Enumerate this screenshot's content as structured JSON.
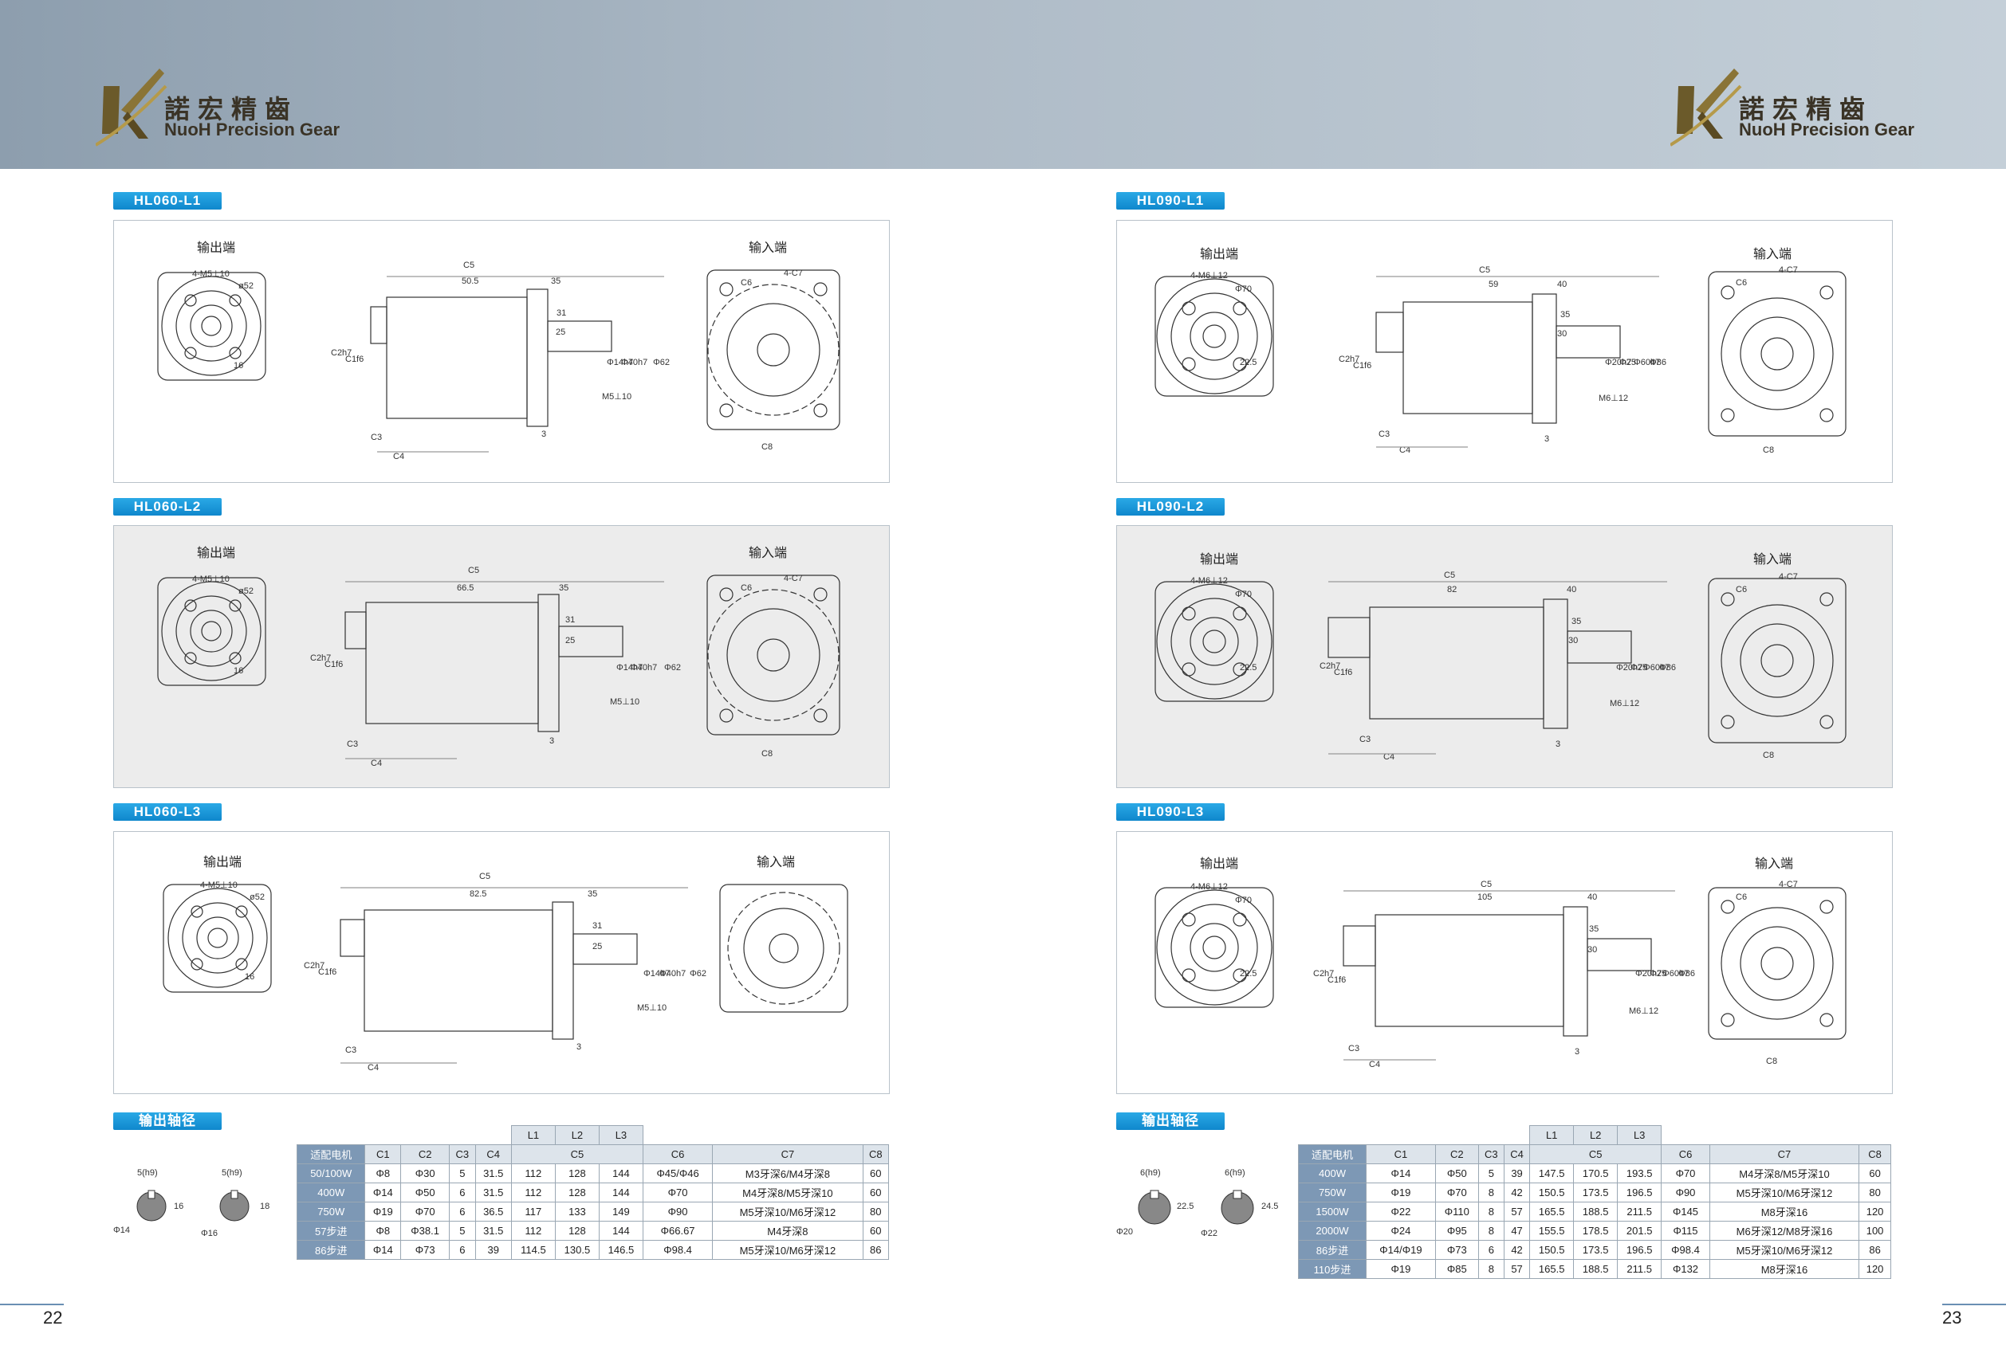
{
  "brand": {
    "name_cn": "諾宏精齒",
    "name_en": "NuoH Precision Gear"
  },
  "labels": {
    "output_end": "输出端",
    "input_end": "输入端"
  },
  "left_page": {
    "sections": [
      {
        "tag": "HL060-L1",
        "hole": "4-M5⊥10",
        "pcd": "ø52",
        "d_c5": "C5",
        "d_len": "50.5",
        "d_35": "35",
        "d_31": "31",
        "d_25": "25",
        "d_3": "3",
        "d_key": "16",
        "d_phi1": "Φ14h7",
        "d_phi2": "Φ40h7",
        "d_phi3": "Φ62",
        "d_mthread": "M5⊥10",
        "c6": "C6",
        "c7": "4-C7",
        "c8": "C8",
        "c2": "C2h7",
        "c1": "C1f6",
        "c3": "C3",
        "c4": "C4"
      },
      {
        "tag": "HL060-L2",
        "hole": "4-M5⊥10",
        "pcd": "ø52",
        "d_c5": "C5",
        "d_len": "66.5",
        "d_35": "35",
        "d_31": "31",
        "d_25": "25",
        "d_3": "3",
        "d_key": "16",
        "d_phi1": "Φ14h7",
        "d_phi2": "Φ40h7",
        "d_phi3": "Φ62",
        "d_mthread": "M5⊥10",
        "c6": "C6",
        "c7": "4-C7",
        "c8": "C8",
        "c2": "C2h7",
        "c1": "C1f6",
        "c3": "C3",
        "c4": "C4"
      },
      {
        "tag": "HL060-L3",
        "hole": "4-M5⊥10",
        "pcd": "ø52",
        "d_c5": "C5",
        "d_len": "82.5",
        "d_35": "35",
        "d_31": "31",
        "d_25": "25",
        "d_3": "3",
        "d_key": "16",
        "d_phi1": "Φ14h7",
        "d_phi2": "Φ40h7",
        "d_phi3": "Φ62",
        "d_mthread": "M5⊥10",
        "c6": "C6",
        "c7": "4-C7",
        "c8": "C8",
        "c2": "C2h7",
        "c1": "C1f6",
        "c3": "C3",
        "c4": "C4"
      }
    ],
    "shaft_tag": "输出轴径",
    "shaft": {
      "a_key": "5(h9)",
      "a_h": "16",
      "a_d": "Φ14",
      "b_key": "5(h9)",
      "b_h": "18",
      "b_d": "Φ16"
    },
    "table": {
      "l_headers": [
        "L1",
        "L2",
        "L3"
      ],
      "headers": [
        "适配电机",
        "C1",
        "C2",
        "C3",
        "C4",
        "C5",
        "C6",
        "C7",
        "C8"
      ],
      "rows": [
        [
          "50/100W",
          "Φ8",
          "Φ30",
          "5",
          "31.5",
          "112",
          "128",
          "144",
          "Φ45/Φ46",
          "M3牙深6/M4牙深8",
          "60"
        ],
        [
          "400W",
          "Φ14",
          "Φ50",
          "6",
          "31.5",
          "112",
          "128",
          "144",
          "Φ70",
          "M4牙深8/M5牙深10",
          "60"
        ],
        [
          "750W",
          "Φ19",
          "Φ70",
          "6",
          "36.5",
          "117",
          "133",
          "149",
          "Φ90",
          "M5牙深10/M6牙深12",
          "80"
        ],
        [
          "57步进",
          "Φ8",
          "Φ38.1",
          "5",
          "31.5",
          "112",
          "128",
          "144",
          "Φ66.67",
          "M4牙深8",
          "60"
        ],
        [
          "86步进",
          "Φ14",
          "Φ73",
          "6",
          "39",
          "114.5",
          "130.5",
          "146.5",
          "Φ98.4",
          "M5牙深10/M6牙深12",
          "86"
        ]
      ]
    },
    "page_number": "22"
  },
  "right_page": {
    "sections": [
      {
        "tag": "HL090-L1",
        "hole": "4-M6⊥12",
        "pcd": "Φ70",
        "d_c5": "C5",
        "d_len": "59",
        "d_35": "40",
        "d_31": "35",
        "d_25": "30",
        "d_3": "3",
        "d_key": "22.5",
        "d_phi1": "Φ20h7",
        "d_phi2": "Φ25",
        "d_phi3": "Φ60h7",
        "d_phi4": "Φ86",
        "d_mthread": "M6⊥12",
        "c6": "C6",
        "c7": "4-C7",
        "c8": "C8",
        "c2": "C2h7",
        "c1": "C1f6",
        "c3": "C3",
        "c4": "C4"
      },
      {
        "tag": "HL090-L2",
        "hole": "4-M6⊥12",
        "pcd": "Φ70",
        "d_c5": "C5",
        "d_len": "82",
        "d_35": "40",
        "d_31": "35",
        "d_25": "30",
        "d_3": "3",
        "d_key": "22.5",
        "d_phi1": "Φ20h7",
        "d_phi2": "Φ25",
        "d_phi3": "Φ60h7",
        "d_phi4": "Φ86",
        "d_mthread": "M6⊥12",
        "c6": "C6",
        "c7": "4-C7",
        "c8": "C8",
        "c2": "C2h7",
        "c1": "C1f6",
        "c3": "C3",
        "c4": "C4"
      },
      {
        "tag": "HL090-L3",
        "hole": "4-M6⊥12",
        "pcd": "Φ70",
        "d_c5": "C5",
        "d_len": "105",
        "d_35": "40",
        "d_31": "35",
        "d_25": "30",
        "d_3": "3",
        "d_key": "22.5",
        "d_phi1": "Φ20h7",
        "d_phi2": "Φ25",
        "d_phi3": "Φ60h7",
        "d_phi4": "Φ86",
        "d_mthread": "M6⊥12",
        "c6": "C6",
        "c7": "4-C7",
        "c8": "C8",
        "c2": "C2h7",
        "c1": "C1f6",
        "c3": "C3",
        "c4": "C4"
      }
    ],
    "shaft_tag": "输出轴径",
    "shaft": {
      "a_key": "6(h9)",
      "a_h": "22.5",
      "a_d": "Φ20",
      "b_key": "6(h9)",
      "b_h": "24.5",
      "b_d": "Φ22"
    },
    "table": {
      "l_headers": [
        "L1",
        "L2",
        "L3"
      ],
      "headers": [
        "适配电机",
        "C1",
        "C2",
        "C3",
        "C4",
        "C5",
        "C6",
        "C7",
        "C8"
      ],
      "rows": [
        [
          "400W",
          "Φ14",
          "Φ50",
          "5",
          "39",
          "147.5",
          "170.5",
          "193.5",
          "Φ70",
          "M4牙深8/M5牙深10",
          "60"
        ],
        [
          "750W",
          "Φ19",
          "Φ70",
          "8",
          "42",
          "150.5",
          "173.5",
          "196.5",
          "Φ90",
          "M5牙深10/M6牙深12",
          "80"
        ],
        [
          "1500W",
          "Φ22",
          "Φ110",
          "8",
          "57",
          "165.5",
          "188.5",
          "211.5",
          "Φ145",
          "M8牙深16",
          "120"
        ],
        [
          "2000W",
          "Φ24",
          "Φ95",
          "8",
          "47",
          "155.5",
          "178.5",
          "201.5",
          "Φ115",
          "M6牙深12/M8牙深16",
          "100"
        ],
        [
          "86步进",
          "Φ14/Φ19",
          "Φ73",
          "6",
          "42",
          "150.5",
          "173.5",
          "196.5",
          "Φ98.4",
          "M5牙深10/M6牙深12",
          "86"
        ],
        [
          "110步进",
          "Φ19",
          "Φ85",
          "8",
          "57",
          "165.5",
          "188.5",
          "211.5",
          "Φ132",
          "M8牙深16",
          "120"
        ]
      ]
    },
    "page_number": "23"
  }
}
